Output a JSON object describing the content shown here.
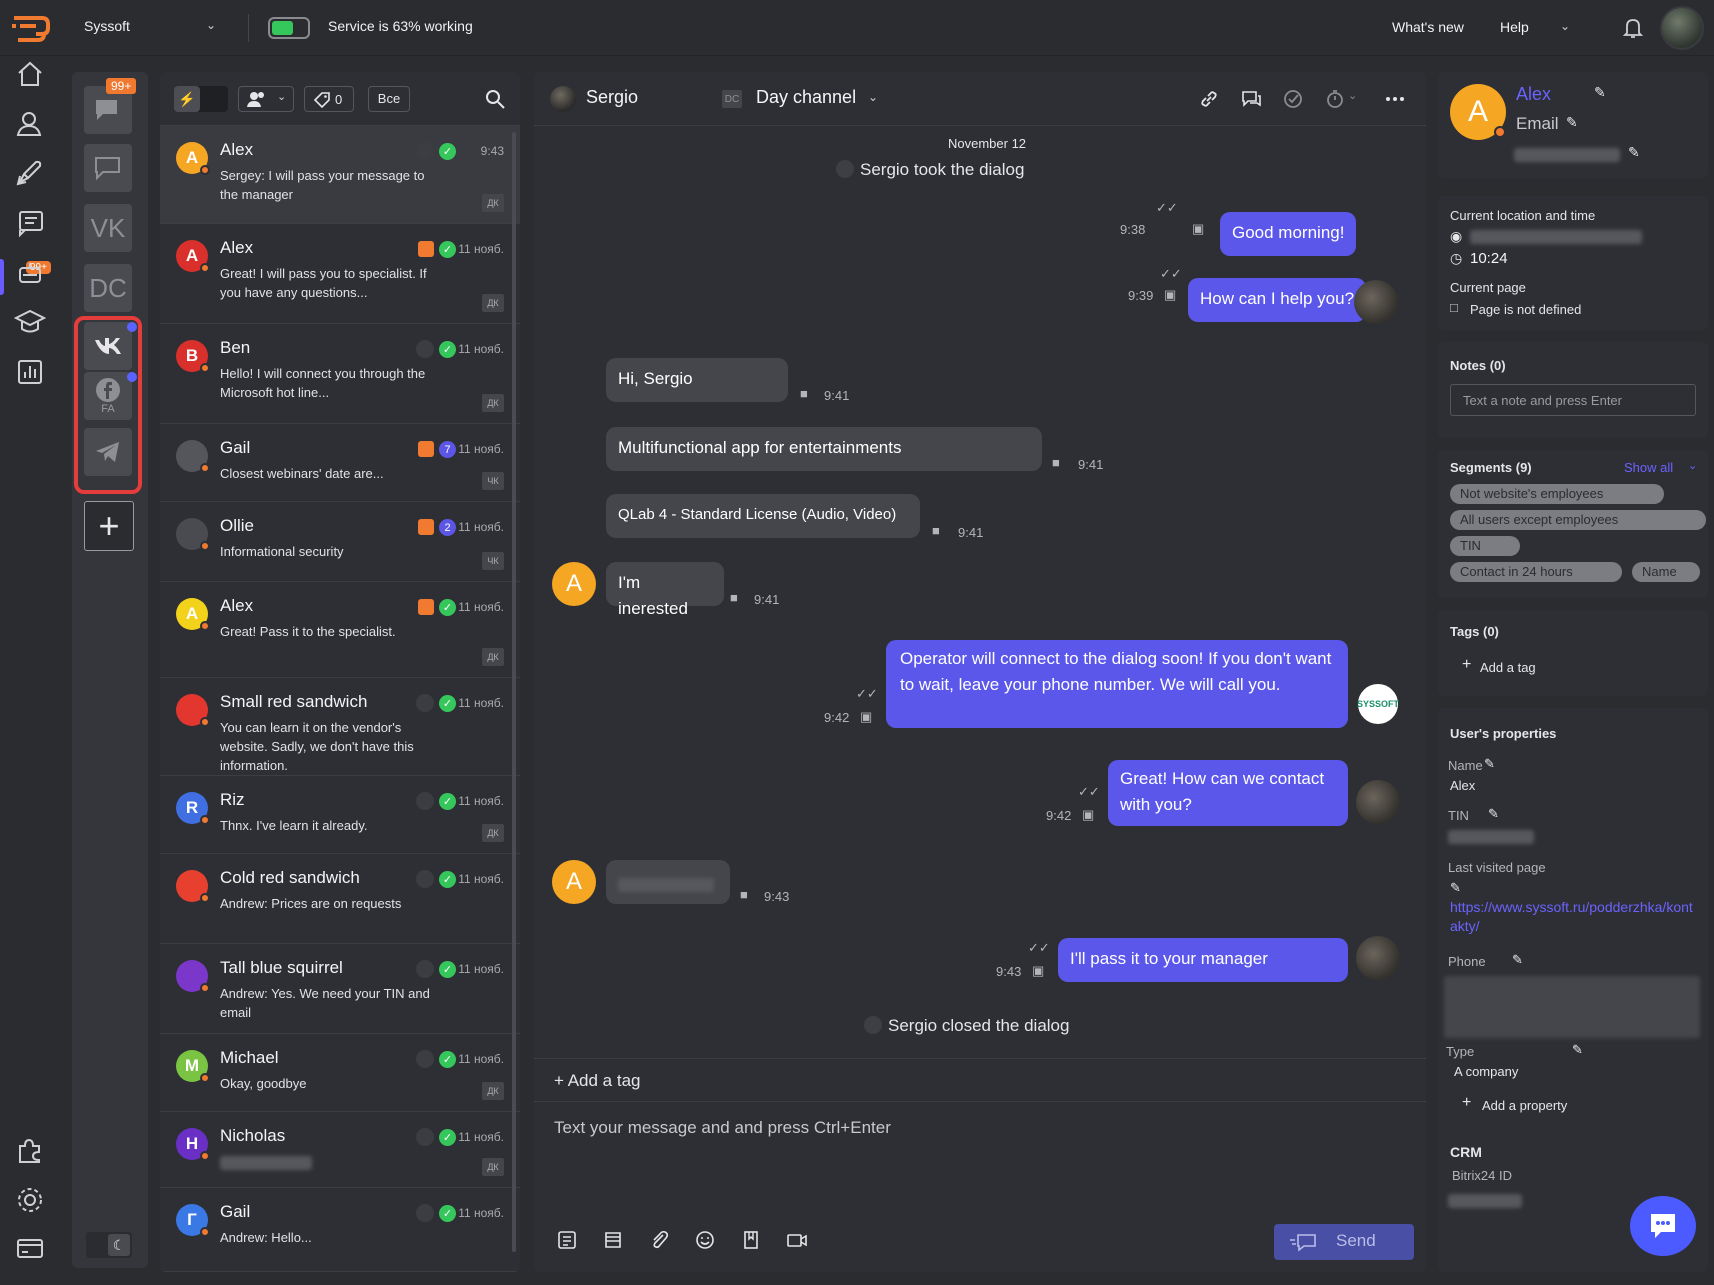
{
  "topbar": {
    "workspace": "Syssoft",
    "service_status": "Service is 63% working",
    "service_progress": 0.63,
    "whats_new": "What's new",
    "help": "Help"
  },
  "nav": {
    "badge": "99+",
    "icons": [
      "home-icon",
      "contacts-icon",
      "campaigns-icon",
      "dialogs-icon",
      "bot-icon",
      "academy-icon",
      "reports-icon",
      "integrations-icon",
      "settings-icon",
      "billing-icon"
    ]
  },
  "channels": {
    "badge": "99+",
    "items": [
      "VK",
      "DC",
      "FA"
    ]
  },
  "convlist": {
    "tag_count": "0",
    "filter_all": "Все",
    "items": [
      {
        "initial": "A",
        "color": "#f5a623",
        "name": "Alex",
        "msg": "Sergey: I will pass your message to the manager",
        "time": "9:43",
        "tag": "ДК"
      },
      {
        "initial": "A",
        "color": "#d9302c",
        "name": "Alex",
        "msg": "Great! I will pass you to specialist. If you have any questions...",
        "time": "11 нояб.",
        "tag": "ДК"
      },
      {
        "initial": "B",
        "color": "#d9302c",
        "name": "Ben",
        "msg": "Hello! I will connect you through the Microsoft hot line...",
        "time": "11 нояб.",
        "tag": "ДК"
      },
      {
        "initial": "",
        "color": "#55565c",
        "name": "Gail",
        "msg": "Closest webinars' date are...",
        "time": "11 нояб.",
        "tag": "ЧК",
        "count": "7"
      },
      {
        "initial": "",
        "color": "#4a4b50",
        "name": "Ollie",
        "msg": "Informational security",
        "time": "11 нояб.",
        "tag": "ЧК",
        "count": "2"
      },
      {
        "initial": "A",
        "color": "#f2d21b",
        "name": "Alex",
        "msg": "Great! Pass it to the specialist.",
        "time": "11 нояб.",
        "tag": "ДК"
      },
      {
        "initial": "",
        "color": "#e3362f",
        "name": "Small red sandwich",
        "msg": "You can learn it on the vendor's website. Sadly, we don't have this information.",
        "time": "11 нояб.",
        "tag": ""
      },
      {
        "initial": "R",
        "color": "#3f6fe0",
        "name": "Riz",
        "msg": "Thnx. I've learn it already.",
        "time": "11 нояб.",
        "tag": "ДК"
      },
      {
        "initial": "",
        "color": "#e8402f",
        "name": "Cold red sandwich",
        "msg": "Andrew: Prices are on requests",
        "time": "11 нояб.",
        "tag": ""
      },
      {
        "initial": "",
        "color": "#7a37c9",
        "name": "Tall blue squirrel",
        "msg": "Andrew: Yes. We need your TIN and email",
        "time": "11 нояб.",
        "tag": ""
      },
      {
        "initial": "M",
        "color": "#7bc443",
        "name": "Michael",
        "msg": "Okay, goodbye",
        "time": "11 нояб.",
        "tag": "ДК"
      },
      {
        "initial": "H",
        "color": "#6a2fc4",
        "name": "Nicholas",
        "msg": "",
        "time": "11 нояб.",
        "tag": "ДК"
      },
      {
        "initial": "Г",
        "color": "#3a78e6",
        "name": "Gail",
        "msg": "Andrew: Hello...",
        "time": "11 нояб.",
        "tag": ""
      }
    ]
  },
  "chat": {
    "operator": "Sergio",
    "channel_badge": "DC",
    "channel": "Day channel",
    "date": "November 12",
    "took": "Sergio took the dialog",
    "closed": "Sergio closed the dialog",
    "messages": {
      "m1": "Good morning!",
      "t1": "9:38",
      "m2": "How can I help you?",
      "t2": "9:39",
      "m3": "Hi, Sergio",
      "t3": "9:41",
      "m4": "Multifunctional app for entertainments",
      "t4": "9:41",
      "m5": "QLab 4 - Standard License (Audio, Video)",
      "t5": "9:41",
      "m6": "I'm inerested",
      "t6": "9:41",
      "m7": "Operator will connect to the dialog soon! If you don't want to wait, leave your phone number. We will call you.",
      "t7": "9:42",
      "m8": "Great! How can we contact with you?",
      "t8": "9:42",
      "t9": "9:43",
      "m10": "I'll pass it to your manager",
      "t10": "9:43"
    },
    "avatar_initial": "A",
    "bot_label": "SYSSOFT",
    "add_tag": "+ Add a tag",
    "composer_placeholder": "Text your message and and press Ctrl+Enter",
    "send": "Send"
  },
  "right": {
    "contact": {
      "initial": "A",
      "name": "Alex",
      "email": "Email"
    },
    "location_label": "Current location and time",
    "local_time": "10:24",
    "page_label": "Current page",
    "page_value": "Page is not defined",
    "notes_label": "Notes (0)",
    "notes_placeholder": "Text a note and press Enter",
    "segments_label": "Segments (9)",
    "show_all": "Show all",
    "segments": [
      "Not website's employees",
      "All users except employees",
      "TIN",
      "Contact in 24 hours",
      "Name"
    ],
    "tags_label": "Tags (0)",
    "add_tag": "Add a tag",
    "props_label": "User's properties",
    "name_label": "Name",
    "name_value": "Alex",
    "tin_label": "TIN",
    "last_page_label": "Last visited page",
    "last_page_value": "https://www.syssoft.ru/podderzhka/kontakty/",
    "phone_label": "Phone",
    "type_label": "Type",
    "type_value": "A company",
    "add_property": "Add a property",
    "crm_label": "CRM",
    "bitrix_label": "Bitrix24 ID"
  },
  "colors": {
    "accent": "#5b57ea",
    "highlight": "#e53c3c",
    "orange": "#f07a2f",
    "green": "#36c75c"
  }
}
